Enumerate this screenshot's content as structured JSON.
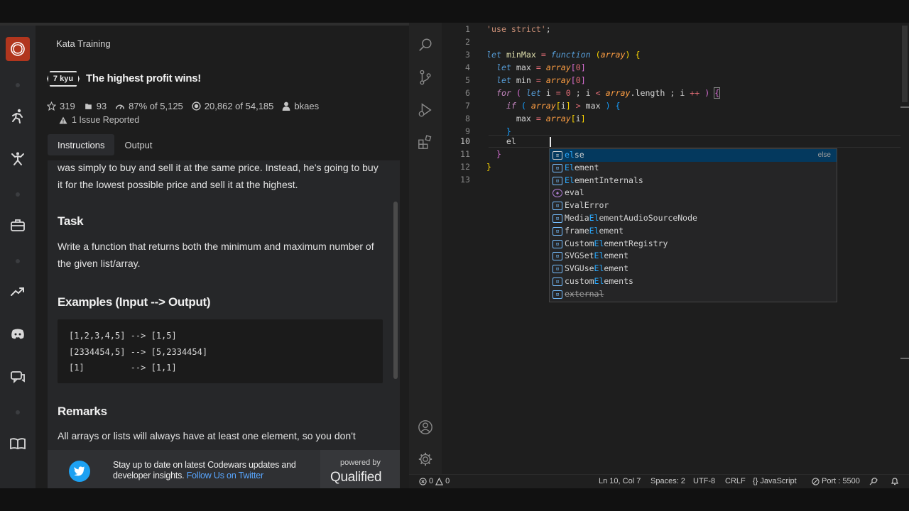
{
  "codewars": {
    "breadcrumb": "Kata Training",
    "kyu": "7 kyu",
    "title": "The highest profit wins!",
    "stats": {
      "stars": "319",
      "collections": "93",
      "satisfaction": "87% of 5,125",
      "completions": "20,862 of 54,185",
      "author": "bkaes"
    },
    "issues": "1 Issue Reported",
    "tabs": [
      "Instructions",
      "Output"
    ],
    "active_tab": "Instructions",
    "description": {
      "intro": "was simply to buy and sell it at the same price. Instead, he's going to buy it for the lowest possible price and sell it at the highest.",
      "task_heading": "Task",
      "task_text": "Write a function that returns both the minimum and maximum number of the given list/array.",
      "examples_heading": "Examples (Input --> Output)",
      "examples": [
        "[1,2,3,4,5] --> [1,5]",
        "[2334454,5] --> [5,2334454]",
        "[1]         --> [1,1]"
      ],
      "remarks_heading": "Remarks",
      "remarks_text": "All arrays or lists will always have at least one element, so you don't"
    },
    "footer": {
      "line1": "Stay up to date on latest Codewars updates and",
      "line2": "developer insights.",
      "link": "Follow Us on Twitter",
      "powered_by": "powered by",
      "brand": "Qualified"
    }
  },
  "editor": {
    "line_numbers": [
      "1",
      "2",
      "3",
      "4",
      "5",
      "6",
      "7",
      "8",
      "9",
      "10",
      "11",
      "12",
      "13"
    ],
    "current_line": 10,
    "suggestions": [
      {
        "label": "else",
        "detail": "else",
        "kind": "keyword"
      },
      {
        "label": "Element",
        "kind": "variable"
      },
      {
        "label": "ElementInternals",
        "kind": "variable"
      },
      {
        "label": "eval",
        "kind": "function"
      },
      {
        "label": "EvalError",
        "kind": "variable"
      },
      {
        "label": "MediaElementAudioSourceNode",
        "kind": "variable"
      },
      {
        "label": "frameElement",
        "kind": "variable"
      },
      {
        "label": "CustomElementRegistry",
        "kind": "variable"
      },
      {
        "label": "SVGSetElement",
        "kind": "variable"
      },
      {
        "label": "SVGUseElement",
        "kind": "variable"
      },
      {
        "label": "customElements",
        "kind": "variable"
      },
      {
        "label": "external",
        "kind": "variable",
        "deprecated": true
      }
    ]
  },
  "statusbar": {
    "errors": "0",
    "warnings": "0",
    "position": "Ln 10, Col 7",
    "spaces": "Spaces: 2",
    "encoding": "UTF-8",
    "eol": "CRLF",
    "language": "JavaScript",
    "port": "Port : 5500"
  },
  "colors": {
    "codewars_red": "#b1361e",
    "twitter_blue": "#1da1f2",
    "suggest_highlight": "#04395e"
  }
}
